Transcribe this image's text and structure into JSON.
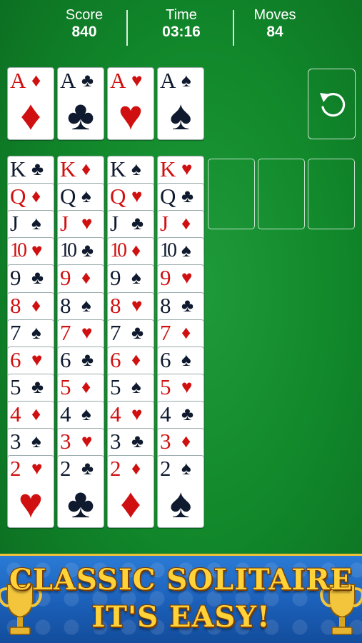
{
  "stats": {
    "score_label": "Score",
    "score_value": "840",
    "time_label": "Time",
    "time_value": "03:16",
    "moves_label": "Moves",
    "moves_value": "84"
  },
  "foundations": [
    {
      "rank": "A",
      "suit": "♦",
      "color": "red"
    },
    {
      "rank": "A",
      "suit": "♣",
      "color": "black"
    },
    {
      "rank": "A",
      "suit": "♥",
      "color": "red"
    },
    {
      "rank": "A",
      "suit": "♠",
      "color": "black"
    }
  ],
  "tableau": [
    [
      {
        "rank": "K",
        "suit": "♣"
      },
      {
        "rank": "Q",
        "suit": "♦"
      },
      {
        "rank": "J",
        "suit": "♠"
      },
      {
        "rank": "10",
        "suit": "♥"
      },
      {
        "rank": "9",
        "suit": "♣"
      },
      {
        "rank": "8",
        "suit": "♦"
      },
      {
        "rank": "7",
        "suit": "♠"
      },
      {
        "rank": "6",
        "suit": "♥"
      },
      {
        "rank": "5",
        "suit": "♣"
      },
      {
        "rank": "4",
        "suit": "♦"
      },
      {
        "rank": "3",
        "suit": "♠"
      },
      {
        "rank": "2",
        "suit": "♥"
      }
    ],
    [
      {
        "rank": "K",
        "suit": "♦"
      },
      {
        "rank": "Q",
        "suit": "♠"
      },
      {
        "rank": "J",
        "suit": "♥"
      },
      {
        "rank": "10",
        "suit": "♣"
      },
      {
        "rank": "9",
        "suit": "♦"
      },
      {
        "rank": "8",
        "suit": "♠"
      },
      {
        "rank": "7",
        "suit": "♥"
      },
      {
        "rank": "6",
        "suit": "♣"
      },
      {
        "rank": "5",
        "suit": "♦"
      },
      {
        "rank": "4",
        "suit": "♠"
      },
      {
        "rank": "3",
        "suit": "♥"
      },
      {
        "rank": "2",
        "suit": "♣"
      }
    ],
    [
      {
        "rank": "K",
        "suit": "♠"
      },
      {
        "rank": "Q",
        "suit": "♥"
      },
      {
        "rank": "J",
        "suit": "♣"
      },
      {
        "rank": "10",
        "suit": "♦"
      },
      {
        "rank": "9",
        "suit": "♠"
      },
      {
        "rank": "8",
        "suit": "♥"
      },
      {
        "rank": "7",
        "suit": "♣"
      },
      {
        "rank": "6",
        "suit": "♦"
      },
      {
        "rank": "5",
        "suit": "♠"
      },
      {
        "rank": "4",
        "suit": "♥"
      },
      {
        "rank": "3",
        "suit": "♣"
      },
      {
        "rank": "2",
        "suit": "♦"
      }
    ],
    [
      {
        "rank": "K",
        "suit": "♥"
      },
      {
        "rank": "Q",
        "suit": "♣"
      },
      {
        "rank": "J",
        "suit": "♦"
      },
      {
        "rank": "10",
        "suit": "♠"
      },
      {
        "rank": "9",
        "suit": "♥"
      },
      {
        "rank": "8",
        "suit": "♣"
      },
      {
        "rank": "7",
        "suit": "♦"
      },
      {
        "rank": "6",
        "suit": "♠"
      },
      {
        "rank": "5",
        "suit": "♥"
      },
      {
        "rank": "4",
        "suit": "♣"
      },
      {
        "rank": "3",
        "suit": "♦"
      },
      {
        "rank": "2",
        "suit": "♠"
      }
    ]
  ],
  "empty_slots": 3,
  "undo_icon": "undo-icon",
  "banner": {
    "line1": "CLASSIC SOLITAIRE",
    "line2": "IT'S EASY!"
  },
  "colors": {
    "red_suit": "#d01010",
    "black_suit": "#0f1a2e",
    "felt": "#128a2c",
    "banner_text": "#ffd23a"
  }
}
